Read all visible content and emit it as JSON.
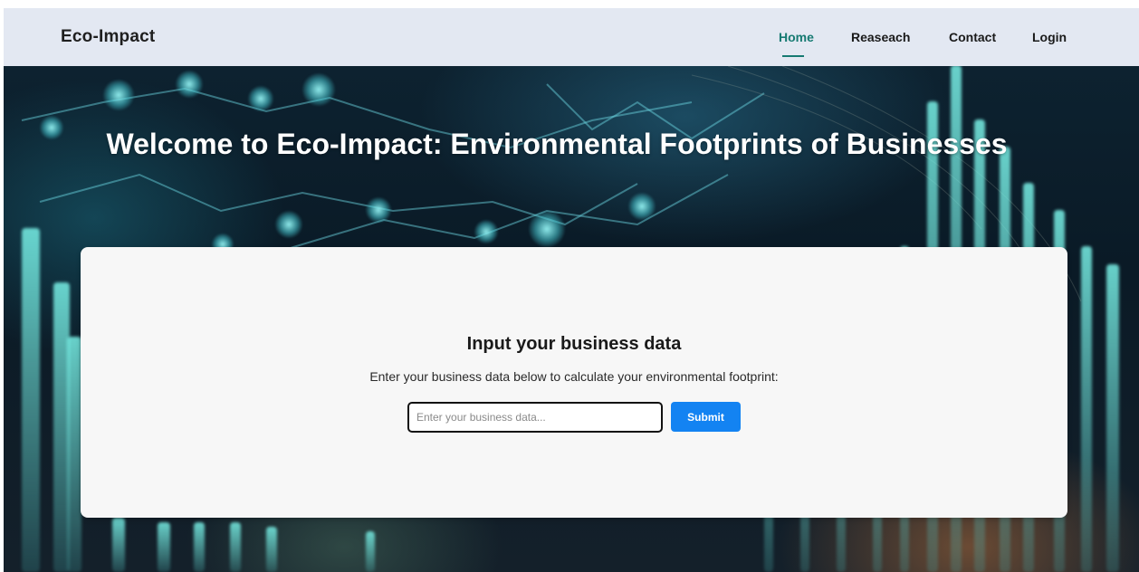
{
  "navbar": {
    "brand": "Eco-Impact",
    "links": [
      {
        "label": "Home",
        "active": true
      },
      {
        "label": "Reaseach",
        "active": false
      },
      {
        "label": "Contact",
        "active": false
      },
      {
        "label": "Login",
        "active": false
      }
    ]
  },
  "hero": {
    "title": "Welcome to Eco-Impact: Environmental Footprints of Businesses"
  },
  "form": {
    "title": "Input your business data",
    "description": "Enter your business data below to calculate your environmental footprint:",
    "input_placeholder": "Enter your business data...",
    "input_value": "",
    "submit_label": "Submit"
  },
  "colors": {
    "accent": "#167a72",
    "button": "#1383f2",
    "navbar_bg": "#e3e8f2",
    "card_bg": "#f7f7f7"
  }
}
